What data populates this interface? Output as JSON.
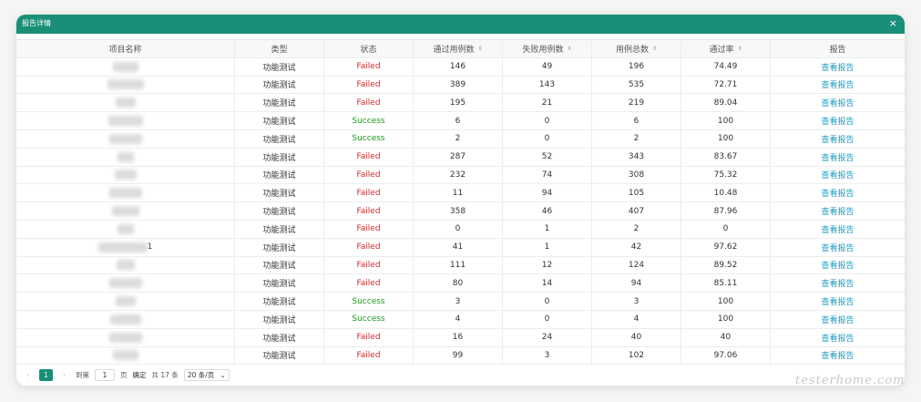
{
  "dialog": {
    "title": "报告详情",
    "close_label": "×"
  },
  "table": {
    "headers": [
      "项目名称",
      "类型",
      "状态",
      "通过用例数",
      "失败用例数",
      "用例总数",
      "通过率",
      "报告"
    ],
    "sort_icon": "⇕",
    "rows": [
      {
        "name": "",
        "type": "功能测试",
        "status": "Failed",
        "pass": "146",
        "fail": "49",
        "total": "196",
        "rate": "74.49",
        "report": "查看报告"
      },
      {
        "name": "",
        "type": "功能测试",
        "status": "Failed",
        "pass": "389",
        "fail": "143",
        "total": "535",
        "rate": "72.71",
        "report": "查看报告"
      },
      {
        "name": "",
        "type": "功能测试",
        "status": "Failed",
        "pass": "195",
        "fail": "21",
        "total": "219",
        "rate": "89.04",
        "report": "查看报告"
      },
      {
        "name": "",
        "type": "功能测试",
        "status": "Success",
        "pass": "6",
        "fail": "0",
        "total": "6",
        "rate": "100",
        "report": "查看报告"
      },
      {
        "name": "",
        "type": "功能测试",
        "status": "Success",
        "pass": "2",
        "fail": "0",
        "total": "2",
        "rate": "100",
        "report": "查看报告"
      },
      {
        "name": "",
        "type": "功能测试",
        "status": "Failed",
        "pass": "287",
        "fail": "52",
        "total": "343",
        "rate": "83.67",
        "report": "查看报告"
      },
      {
        "name": "",
        "type": "功能测试",
        "status": "Failed",
        "pass": "232",
        "fail": "74",
        "total": "308",
        "rate": "75.32",
        "report": "查看报告"
      },
      {
        "name": "",
        "type": "功能测试",
        "status": "Failed",
        "pass": "11",
        "fail": "94",
        "total": "105",
        "rate": "10.48",
        "report": "查看报告"
      },
      {
        "name": "",
        "type": "功能测试",
        "status": "Failed",
        "pass": "358",
        "fail": "46",
        "total": "407",
        "rate": "87.96",
        "report": "查看报告"
      },
      {
        "name": "",
        "type": "功能测试",
        "status": "Failed",
        "pass": "0",
        "fail": "1",
        "total": "2",
        "rate": "0",
        "report": "查看报告"
      },
      {
        "name": "1",
        "type": "功能测试",
        "status": "Failed",
        "pass": "41",
        "fail": "1",
        "total": "42",
        "rate": "97.62",
        "report": "查看报告"
      },
      {
        "name": "",
        "type": "功能测试",
        "status": "Failed",
        "pass": "111",
        "fail": "12",
        "total": "124",
        "rate": "89.52",
        "report": "查看报告"
      },
      {
        "name": "",
        "type": "功能测试",
        "status": "Failed",
        "pass": "80",
        "fail": "14",
        "total": "94",
        "rate": "85.11",
        "report": "查看报告"
      },
      {
        "name": "",
        "type": "功能测试",
        "status": "Success",
        "pass": "3",
        "fail": "0",
        "total": "3",
        "rate": "100",
        "report": "查看报告"
      },
      {
        "name": "",
        "type": "功能测试",
        "status": "Success",
        "pass": "4",
        "fail": "0",
        "total": "4",
        "rate": "100",
        "report": "查看报告"
      },
      {
        "name": "",
        "type": "功能测试",
        "status": "Failed",
        "pass": "16",
        "fail": "24",
        "total": "40",
        "rate": "40",
        "report": "查看报告"
      },
      {
        "name": "",
        "type": "功能测试",
        "status": "Failed",
        "pass": "99",
        "fail": "3",
        "total": "102",
        "rate": "97.06",
        "report": "查看报告"
      }
    ]
  },
  "pagination": {
    "prev_icon": "‹",
    "current_page": "1",
    "next_icon": "›",
    "goto_label": "到第",
    "goto_value": "1",
    "page_unit": "页",
    "confirm_label": "确定",
    "total_label": "共 17 条",
    "page_size": "20 条/页",
    "dropdown_icon": "⌄"
  },
  "colors": {
    "accent": "#1a8f77",
    "failed": "#d62828",
    "success": "#1a9b1a",
    "link": "#1f9dc2"
  },
  "watermark": "testerhome.com"
}
